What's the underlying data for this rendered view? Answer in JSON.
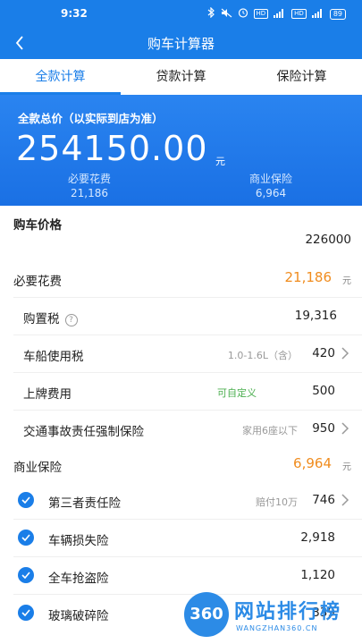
{
  "status_bar": {
    "time": "9:32",
    "icons": [
      "bluetooth-icon",
      "mute-icon",
      "alarm-icon",
      "hd-icon",
      "5g-signal-icon",
      "hd2-icon",
      "4g-signal-icon",
      "battery-icon"
    ],
    "hd": "HD",
    "fiveg": "5G",
    "fourg": "4G",
    "battery": "89"
  },
  "nav": {
    "title": "购车计算器",
    "back_icon": "chevron-left-icon"
  },
  "tabs": [
    {
      "label": "全款计算",
      "active": true
    },
    {
      "label": "贷款计算",
      "active": false
    },
    {
      "label": "保险计算",
      "active": false
    }
  ],
  "summary": {
    "label": "全款总价（以实际到店为准）",
    "total": "254150.00",
    "unit": "元",
    "necessary_label": "必要花费",
    "necessary_value": "21,186",
    "commercial_label": "商业保险",
    "commercial_value": "6,964"
  },
  "purchase_price": {
    "label": "购车价格",
    "value": "226000"
  },
  "necessary": {
    "label": "必要花费",
    "value": "21,186",
    "unit": "元",
    "items": [
      {
        "label": "购置税",
        "note": "",
        "value": "19,316",
        "has_help": true,
        "has_chevron": false
      },
      {
        "label": "车船使用税",
        "note": "1.0-1.6L（含）",
        "value": "420",
        "has_help": false,
        "has_chevron": true
      },
      {
        "label": "上牌费用",
        "note": "可自定义",
        "value": "500",
        "has_help": false,
        "has_chevron": false
      },
      {
        "label": "交通事故责任强制保险",
        "note": "家用6座以下",
        "value": "950",
        "has_help": false,
        "has_chevron": true
      }
    ]
  },
  "commercial": {
    "label": "商业保险",
    "value": "6,964",
    "unit": "元",
    "items": [
      {
        "label": "第三者责任险",
        "note": "赔付10万",
        "value": "746",
        "checked": true,
        "has_chevron": true
      },
      {
        "label": "车辆损失险",
        "note": "",
        "value": "2,918",
        "checked": true,
        "has_chevron": false
      },
      {
        "label": "全车抢盗险",
        "note": "",
        "value": "1,120",
        "checked": true,
        "has_chevron": false
      },
      {
        "label": "玻璃破碎险",
        "note": "",
        "value": "339",
        "checked": true,
        "has_chevron": false
      }
    ]
  },
  "colors": {
    "brand_blue": "#1a7ee8",
    "accent_orange": "#f08c1e",
    "note_green": "#4caf50"
  },
  "watermark": {
    "logo": "360",
    "text": "网站排行榜",
    "sub": "WANGZHAN360.CN"
  }
}
